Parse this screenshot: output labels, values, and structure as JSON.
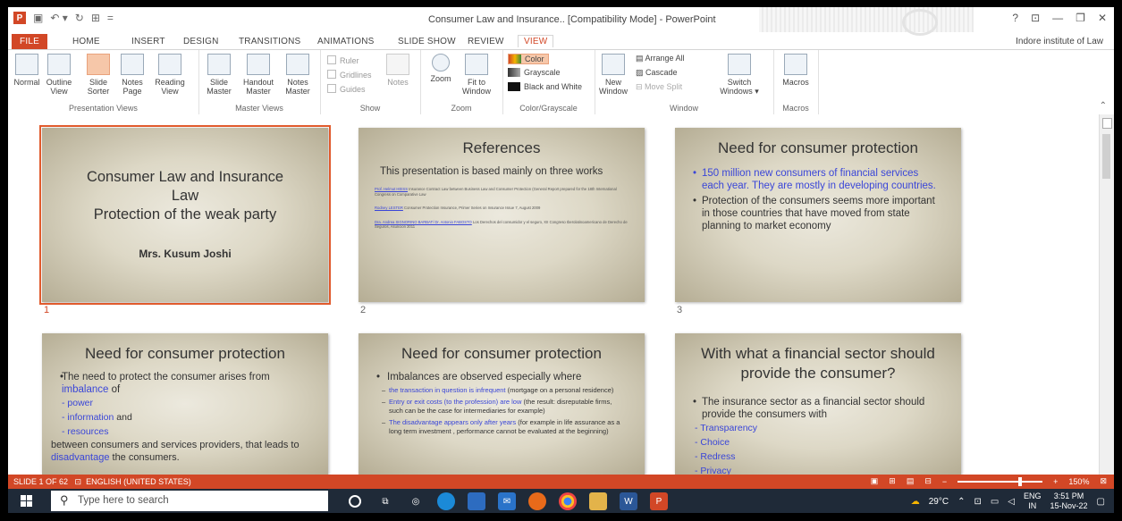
{
  "titlebar": {
    "app_icon": "P",
    "document_title": "Consumer Law and Insurance.. [Compatibility Mode] - PowerPoint",
    "help": "?",
    "ribbon_display": "⊡",
    "minimize": "—",
    "restore": "❐",
    "close": "✕"
  },
  "tabs": [
    "FILE",
    "HOME",
    "INSERT",
    "DESIGN",
    "TRANSITIONS",
    "ANIMATIONS",
    "SLIDE SHOW",
    "REVIEW",
    "VIEW"
  ],
  "account": "Indore institute of Law",
  "ribbon": {
    "presentation_views": {
      "label": "Presentation Views",
      "buttons": [
        "Normal",
        "Outline View",
        "Slide Sorter",
        "Notes Page",
        "Reading View"
      ]
    },
    "master_views": {
      "label": "Master Views",
      "buttons": [
        "Slide Master",
        "Handout Master",
        "Notes Master"
      ]
    },
    "show": {
      "label": "Show",
      "checks": [
        "Ruler",
        "Gridlines",
        "Guides"
      ],
      "notes": "Notes"
    },
    "zoom": {
      "label": "Zoom",
      "buttons": [
        "Zoom",
        "Fit to Window"
      ]
    },
    "color_grayscale": {
      "label": "Color/Grayscale",
      "options": [
        "Color",
        "Grayscale",
        "Black and White"
      ]
    },
    "window": {
      "label": "Window",
      "new_window": "New Window",
      "items": [
        "Arrange All",
        "Cascade",
        "Move Split"
      ],
      "switch": "Switch Windows"
    },
    "macros": {
      "label": "Macros",
      "button": "Macros"
    }
  },
  "slides": [
    {
      "number": "1",
      "title_lines": [
        "Consumer Law and Insurance",
        "Law",
        "Protection of the weak party"
      ],
      "author": "Mrs. Kusum Joshi"
    },
    {
      "number": "2",
      "title": "References",
      "intro": "This presentation is based mainly on three works",
      "refs": [
        {
          "link": "Prof. Helmut HEISS",
          "text": " Insurance Contract Law between Business Law and Consumer Protection (General Report prepared for the 18th International Congress on Comparative Law"
        },
        {
          "link": "Rodney LESTER",
          "text": " Consumer Protection Insurance, Primer Series on Insurance  Issue 7, August 2009"
        },
        {
          "link": "Dra. Andrea SIGNORINO BARBAT/ Dr. Antonio FABOSTO",
          "text": " Los Derechos del consumidor y el seguro,  XII Congreso Iberolatinoamericano de Derecho de Seguros, Asuncion 2011"
        }
      ]
    },
    {
      "number": "3",
      "title": "Need for consumer protection",
      "bullets": [
        "150 million new consumers of financial services each year. They are mostly in developing countries.",
        "Protection of the consumers seems more important in those countries that have moved from state planning to market economy"
      ]
    },
    {
      "title": "Need for consumer protection",
      "bullet_pre": "The need to protect the consumer arises from ",
      "bullet_hl": "imbalance",
      "bullet_post": " of",
      "dashes": [
        "power",
        "information",
        "resources"
      ],
      "dash_suffix": " and",
      "tail_pre": "between consumers and services providers, that leads to ",
      "tail_hl": "disadvantage",
      "tail_post": " the consumers."
    },
    {
      "title": "Need for consumer protection",
      "bullet": "Imbalances are observed especially where",
      "subs": [
        {
          "hl": "the transaction in question is infrequent",
          "rest": " (mortgage on a personal residence)"
        },
        {
          "hl": "Entry or exit costs (to the profession) are low",
          "rest": " (the result: disreputable firms, such can be the case for intermediaries for example)"
        },
        {
          "hl": "The disadvantage appears only after years",
          "rest": " (for example in life assurance as a long term investment , performance cannot be evaluated at the beginning)"
        }
      ]
    },
    {
      "title": "With what a financial sector should provide the consumer?",
      "bullet": "The insurance sector as a financial sector should provide the consumers with",
      "dashes": [
        "Transparency",
        "Choice",
        "Redress",
        "Privacy"
      ]
    }
  ],
  "statusbar": {
    "slide": "SLIDE 1 OF 62",
    "language": "ENGLISH (UNITED STATES)",
    "zoom": "150%"
  },
  "taskbar": {
    "search_placeholder": "Type here to search",
    "temperature": "29°C",
    "lang": "ENG",
    "region": "IN",
    "time": "3:51 PM",
    "date": "15-Nov-22"
  }
}
